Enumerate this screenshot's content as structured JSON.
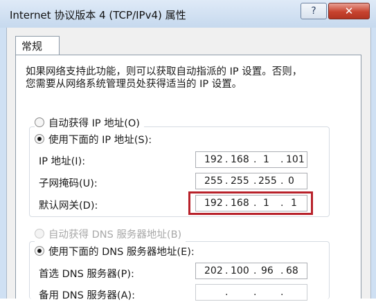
{
  "window": {
    "title": "Internet 协议版本 4 (TCP/IPv4) 属性",
    "help_button": "?",
    "close_button": "✕"
  },
  "tabs": [
    {
      "label": "常规",
      "selected": true
    }
  ],
  "description": {
    "line1": "如果网络支持此功能，则可以获取自动指派的 IP 设置。否则，",
    "line2": "您需要从网络系统管理员处获得适当的 IP 设置。"
  },
  "ip_section": {
    "auto_option": {
      "label": "自动获得 IP 地址(O)",
      "checked": false
    },
    "manual_option": {
      "label": "使用下面的 IP 地址(S):",
      "checked": true
    },
    "fields": [
      {
        "label": "IP 地址(I):",
        "octets": [
          "192",
          "168",
          "1",
          "101"
        ]
      },
      {
        "label": "子网掩码(U):",
        "octets": [
          "255",
          "255",
          "255",
          "0"
        ]
      },
      {
        "label": "默认网关(D):",
        "octets": [
          "192",
          "168",
          "1",
          "1"
        ],
        "highlighted": true
      }
    ]
  },
  "dns_section": {
    "auto_option": {
      "label": "自动获得 DNS 服务器地址(B)",
      "checked": false,
      "disabled": true
    },
    "manual_option": {
      "label": "使用下面的 DNS 服务器地址(E):",
      "checked": true
    },
    "fields": [
      {
        "label": "首选 DNS 服务器(P):",
        "octets": [
          "202",
          "100",
          "96",
          "68"
        ]
      },
      {
        "label": "备用 DNS 服务器(A):",
        "octets": [
          "",
          "",
          "",
          ""
        ]
      }
    ]
  },
  "colors": {
    "highlight_border": "#b8212a",
    "title_bar": "#cfe0f3",
    "close_button": "#c7432f"
  }
}
